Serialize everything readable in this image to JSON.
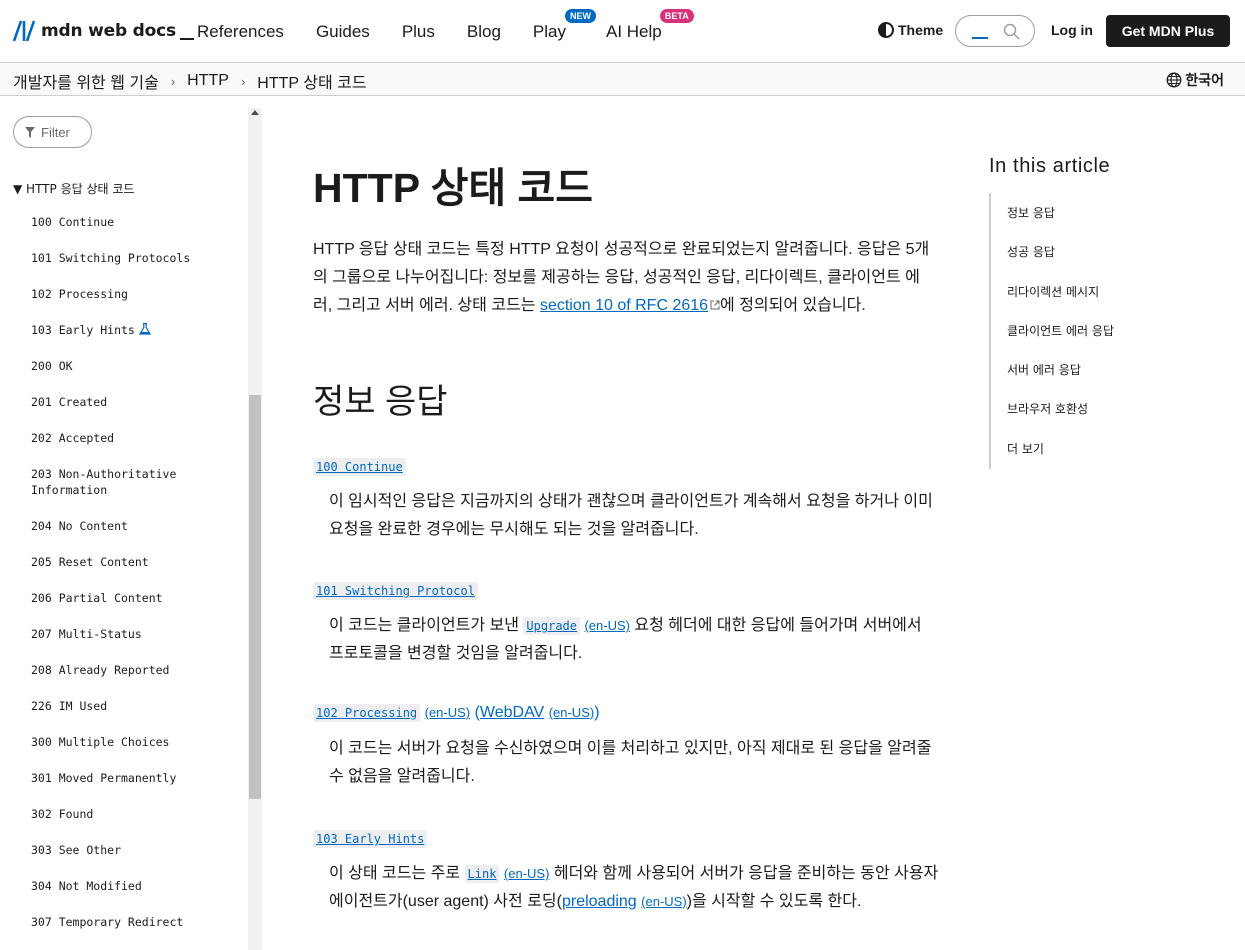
{
  "header": {
    "logo_text": "mdn web docs",
    "nav": [
      {
        "label": "References",
        "badge": ""
      },
      {
        "label": "Guides",
        "badge": ""
      },
      {
        "label": "Plus",
        "badge": ""
      },
      {
        "label": "Blog",
        "badge": ""
      },
      {
        "label": "Play",
        "badge": "NEW"
      },
      {
        "label": "AI Help",
        "badge": "BETA"
      }
    ],
    "theme_label": "Theme",
    "login_label": "Log in",
    "get_plus_label": "Get MDN Plus",
    "colors": {
      "brand": "#1b1b1b",
      "link": "#0069c2",
      "new_badge": "#0069c2",
      "beta_badge": "#d7317d"
    }
  },
  "breadcrumb": {
    "items": [
      "개발자를 위한 웹 기술",
      "HTTP",
      "HTTP 상태 코드"
    ],
    "separator": "›",
    "language": "한국어"
  },
  "sidebar": {
    "filter_placeholder": "Filter",
    "section_title": "▼ HTTP 응답 상태 코드",
    "items": [
      "100 Continue",
      "101 Switching Protocols",
      "102 Processing",
      "103 Early Hints",
      "200 OK",
      "201 Created",
      "202 Accepted",
      "203 Non-Authoritative Information",
      "204 No Content",
      "205 Reset Content",
      "206 Partial Content",
      "207 Multi-Status",
      "208 Already Reported",
      "226 IM Used",
      "300 Multiple Choices",
      "301 Moved Permanently",
      "302 Found",
      "303 See Other",
      "304 Not Modified",
      "307 Temporary Redirect"
    ]
  },
  "main": {
    "title": "HTTP 상태 코드",
    "intro_before": "HTTP 응답 상태 코드는 특정 HTTP 요청이 성공적으로 완료되었는지 알려줍니다. 응답은 5개의 그룹으로 나누어집니다: 정보를 제공하는 응답, 성공적인 응답, 리다이렉트, 클라이언트 에러, 그리고 서버 에러. 상태 코드는 ",
    "intro_link": "section 10 of RFC 2616",
    "intro_after": "에 정의되어 있습니다.",
    "section_heading": "정보 응답",
    "entries": [
      {
        "code": "100 Continue",
        "desc": "이 임시적인 응답은 지금까지의 상태가 괜찮으며 클라이언트가 계속해서 요청을 하거나 이미 요청을 완료한 경우에는 무시해도 되는 것을 알려줍니다."
      },
      {
        "code": "101 Switching Protocol",
        "desc_before": "이 코드는 클라이언트가 보낸 ",
        "desc_code": "Upgrade",
        "desc_enus": "(en-US)",
        "desc_after": " 요청 헤더에 대한 응답에 들어가며 서버에서 프로토콜을 변경할 것임을 알려줍니다."
      },
      {
        "code": "102 Processing",
        "code_enus": "(en-US)",
        "paren_open": "(",
        "paren_link": "WebDAV",
        "paren_enus": "(en-US)",
        "paren_close": ")",
        "desc": "이 코드는 서버가 요청을 수신하였으며 이를 처리하고 있지만, 아직 제대로 된 응답을 알려줄 수 없음을 알려줍니다."
      },
      {
        "code": "103 Early Hints",
        "desc_before": "이 상태 코드는 주로 ",
        "desc_code": "Link",
        "desc_enus": "(en-US)",
        "desc_middle": " 헤더와 함께 사용되어 서버가 응답을 준비하는 동안 사용자 에이전트가(user agent) 사전 로딩(",
        "desc_link": "preloading",
        "desc_link_enus": "(en-US)",
        "desc_after": ")을 시작할 수 있도록 한다."
      }
    ]
  },
  "toc": {
    "title": "In this article",
    "items": [
      "정보 응답",
      "성공 응답",
      "리다이렉션 메시지",
      "클라이언트 에러 응답",
      "서버 에러 응답",
      "브라우저 호환성",
      "더 보기"
    ]
  }
}
